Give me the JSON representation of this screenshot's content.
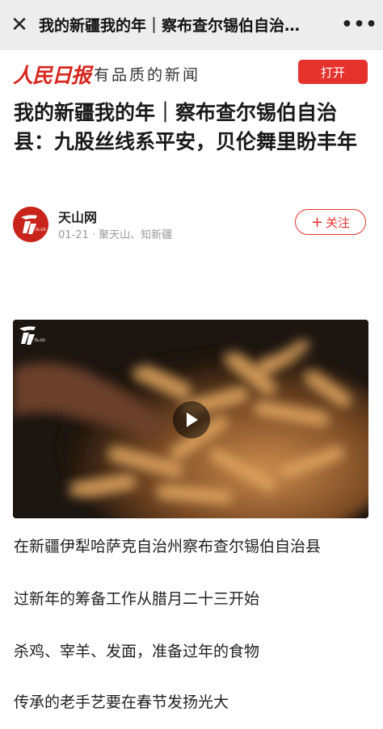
{
  "topbar": {
    "close_icon": "close-icon",
    "title": "我的新疆我的年｜察布查尔锡伯自治…",
    "more_icon": "more-dots-icon"
  },
  "brand": {
    "logo_text": "人民日报",
    "slogan": "有品质的新闻",
    "open_label": "打开",
    "accent": "#e5322d"
  },
  "article": {
    "title": "我的新疆我的年｜察布查尔锡伯自治县：九股丝线系平安，贝伦舞里盼丰年"
  },
  "author": {
    "name": "天山网",
    "meta": "01-21 · 聚天山、知新疆",
    "follow_label": "关注",
    "avatar_icon": "tianshan-logo-icon"
  },
  "video": {
    "play_icon": "play-icon",
    "watermark_icon": "tianshan-watermark-icon"
  },
  "paragraphs": [
    "在新疆伊犁哈萨克自治州察布查尔锡伯自治县",
    "过新年的筹备工作从腊月二十三开始",
    "杀鸡、宰羊、发面，准备过年的食物",
    "传承的老手艺要在春节发扬光大"
  ]
}
